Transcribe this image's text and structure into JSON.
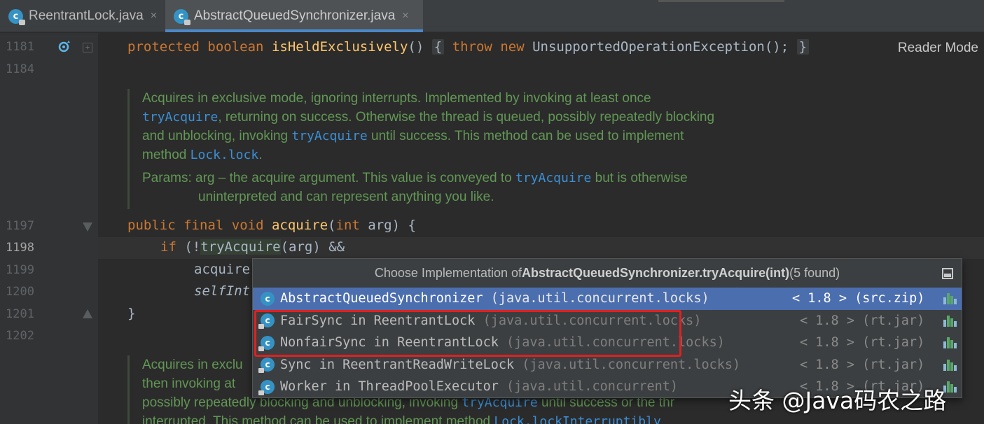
{
  "tabs": [
    {
      "label": "ReentrantLock.java",
      "close": "×",
      "icon": "c"
    },
    {
      "label": "AbstractQueuedSynchronizer.java",
      "close": "×",
      "icon": "c"
    }
  ],
  "reader_mode": "Reader Mode",
  "line_numbers": {
    "l1181": "1181",
    "l1184": "1184",
    "l1197": "1197",
    "l1198": "1198",
    "l1199": "1199",
    "l1200": "1200",
    "l1201": "1201",
    "l1202": "1202"
  },
  "code": {
    "l1181": {
      "kw1": "protected",
      "kw2": "boolean",
      "fn": "isHeldExclusively",
      "paren": "()",
      "open": "{",
      "kw3": "throw",
      "kw4": "new",
      "call": "UnsupportedOperationException();",
      "close": "}"
    },
    "l1197": {
      "kw1": "public",
      "kw2": "final",
      "kw3": "void",
      "fn": "acquire",
      "sig_a": "(",
      "kw4": "int",
      "sig_b": " arg) {"
    },
    "l1198": {
      "kw": "if",
      "a": " (!",
      "hl": "tryAcquire",
      "b": "(arg) &&"
    },
    "l1199": "acquire",
    "l1200": "selfInt",
    "l1201": "}"
  },
  "doc1": {
    "p1_a": "Acquires in exclusive mode, ignoring interrupts. Implemented by invoking at least once",
    "p1_code1": "tryAcquire",
    "p1_b": ", returning on success. Otherwise the thread is queued, possibly repeatedly blocking",
    "p1_c": "and unblocking, invoking ",
    "p1_code2": "tryAcquire",
    "p1_d": " until success. This method can be used to implement",
    "p1_e": "method ",
    "p1_code3": "Lock.lock",
    "p1_f": ".",
    "params_a": "Params: arg – the acquire argument. This value is conveyed to ",
    "params_code": "tryAcquire",
    "params_b": " but is otherwise",
    "params_c": "uninterpreted and can represent anything you like."
  },
  "doc2": {
    "l1": "Acquires in exclu",
    "l2": "then invoking at",
    "l3_a": "possibly repeatedly blocking and unblocking, invoking ",
    "l3_code": "tryAcquire",
    "l3_b": " until success or the thr",
    "l4_a": "interrupted. This method can be used to implement method ",
    "l4_code": "Lock.lockInterruptibly"
  },
  "popup": {
    "title_prefix": "Choose Implementation of ",
    "title_bold": "AbstractQueuedSynchronizer.tryAcquire(int)",
    "title_suffix": " (5 found)",
    "items": [
      {
        "name": "AbstractQueuedSynchronizer",
        "pkg": " (java.util.concurrent.locks)",
        "version": "< 1.8 > (src.zip)",
        "selected": true
      },
      {
        "name": "FairSync in ReentrantLock",
        "pkg": " (java.util.concurrent.locks)",
        "version": "< 1.8 > (rt.jar)",
        "selected": false
      },
      {
        "name": "NonfairSync in ReentrantLock",
        "pkg": " (java.util.concurrent.locks)",
        "version": "< 1.8 > (rt.jar)",
        "selected": false
      },
      {
        "name": "Sync in ReentrantReadWriteLock",
        "pkg": " (java.util.concurrent.locks)",
        "version": "< 1.8 > (rt.jar)",
        "selected": false
      },
      {
        "name": "Worker in ThreadPoolExecutor",
        "pkg": " (java.util.concurrent)",
        "version": "< 1.8 > (rt.jar)",
        "selected": false
      }
    ]
  },
  "watermark": "头条 @Java码农之路",
  "colors": {
    "background": "#2b2b2b",
    "keyword": "#cc7832",
    "method": "#ffc66d",
    "doc": "#629755",
    "doc_link": "#3b8fd6",
    "selection": "#4b6eaf",
    "highlight_box": "#e02020"
  }
}
